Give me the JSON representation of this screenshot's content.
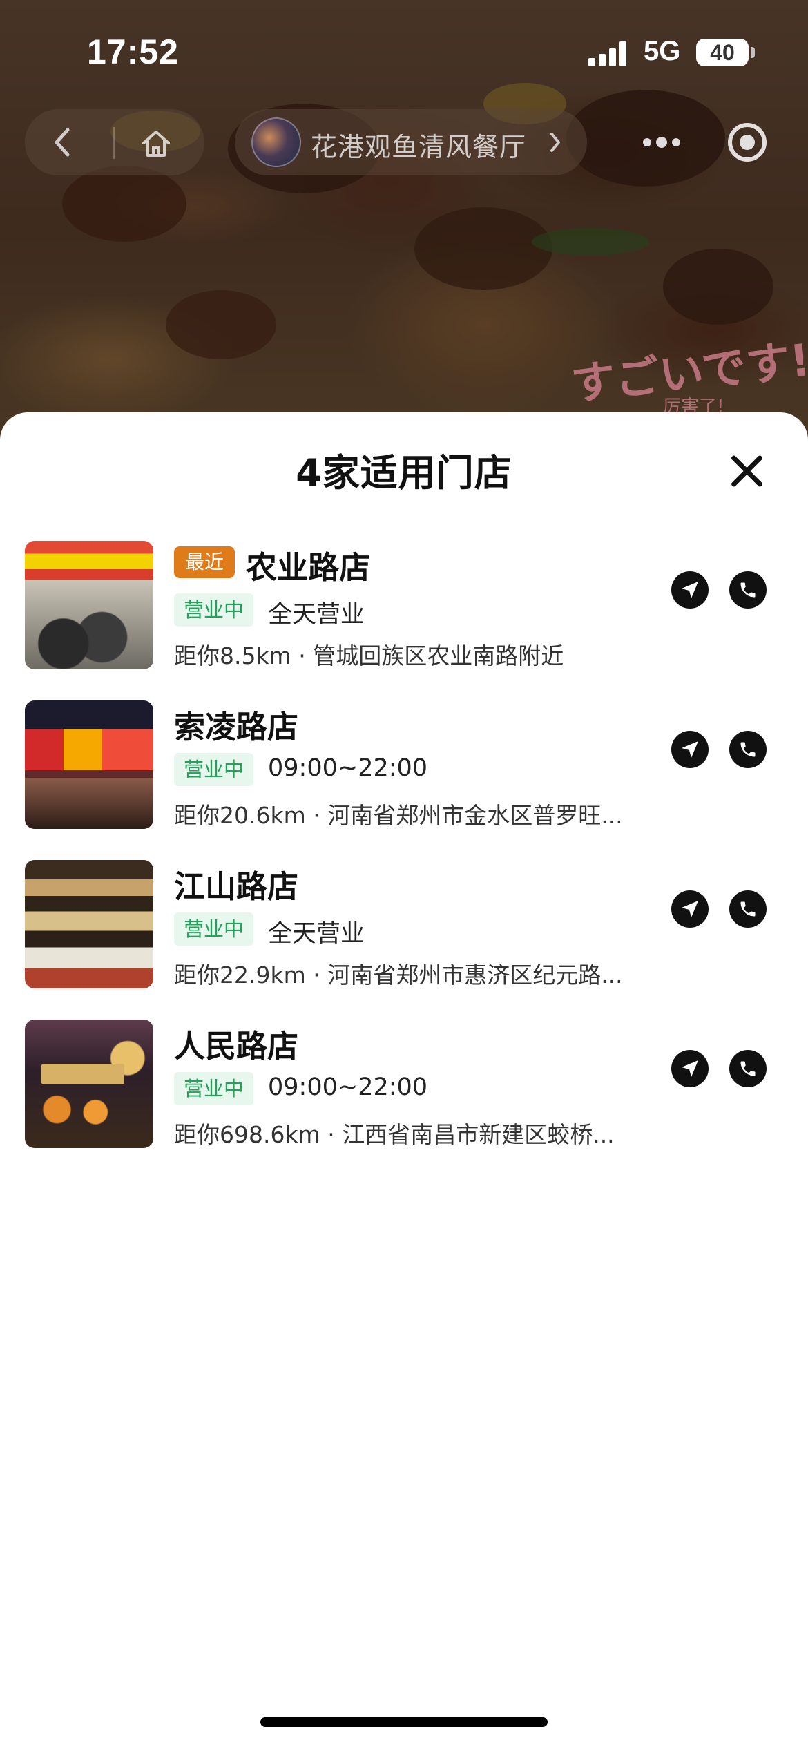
{
  "status_bar": {
    "time": "17:52",
    "network": "5G",
    "battery": "40"
  },
  "nav": {
    "shop_name": "花港观鱼清风餐厅",
    "back_icon": "chevron-left-icon",
    "home_icon": "home-icon",
    "more_icon": "more-dots-icon",
    "target_icon": "target-icon"
  },
  "background": {
    "watermark": "すごいです!",
    "watermark_sub": "厉害了!"
  },
  "sheet": {
    "title": "4家适用门店",
    "close_icon": "close-icon"
  },
  "stores": [
    {
      "badge": "最近",
      "name": "农业路店",
      "status": "营业中",
      "hours": "全天营业",
      "address": "距你8.5km · 管城回族区农业南路附近"
    },
    {
      "name": "索凌路店",
      "status": "营业中",
      "hours": "09:00~22:00",
      "address": "距你20.6km · 河南省郑州市金水区普罗旺..."
    },
    {
      "name": "江山路店",
      "status": "营业中",
      "hours": "全天营业",
      "address": "距你22.9km · 河南省郑州市惠济区纪元路..."
    },
    {
      "name": "人民路店",
      "status": "营业中",
      "hours": "09:00~22:00",
      "address": "距你698.6km · 江西省南昌市新建区蛟桥..."
    }
  ],
  "colors": {
    "badge_recent": "#e07b1a",
    "status_text": "#21a35a",
    "status_bg": "#e8f7ee"
  }
}
